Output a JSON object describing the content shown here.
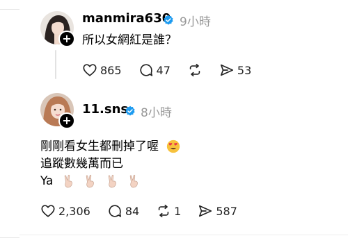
{
  "post1": {
    "username": "manmira630",
    "time": "9小時",
    "text": "所以女網紅是誰？",
    "likes": "865",
    "comments": "47",
    "shares": "53"
  },
  "post2": {
    "username": "11.sns",
    "time": "8小時",
    "line1": "剛剛看女生都刪掉了喔",
    "line2": "追蹤數幾萬而已",
    "line3": "Ya",
    "likes": "2,306",
    "comments": "84",
    "reposts": "1",
    "shares": "587"
  },
  "colors": {
    "verified": "#1d9bf0",
    "muted": "#999999"
  },
  "icons": [
    "heart-icon",
    "comment-icon",
    "repost-icon",
    "share-icon",
    "verified-icon",
    "plus-icon",
    "heart-eyes-emoji",
    "victory-hand-emoji"
  ]
}
